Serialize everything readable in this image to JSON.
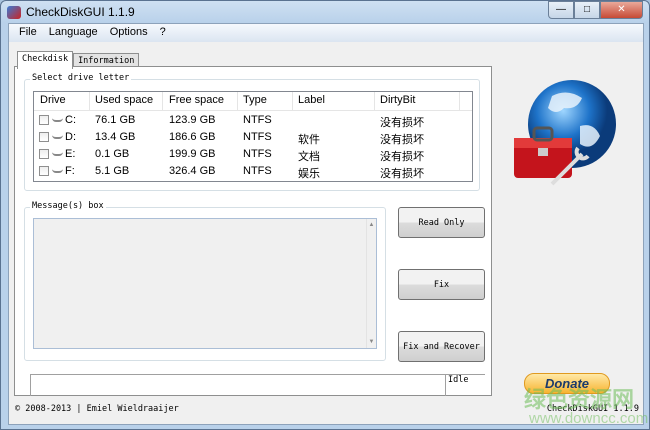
{
  "window": {
    "title": "CheckDiskGUI 1.1.9",
    "controls": [
      "minimize",
      "maximize",
      "close"
    ]
  },
  "menu": [
    "File",
    "Language",
    "Options",
    "?"
  ],
  "tabs": [
    {
      "label": "Checkdisk",
      "active": true
    },
    {
      "label": "Information",
      "active": false
    }
  ],
  "drives": {
    "group_label": "Select drive letter",
    "columns": [
      "Drive",
      "Used space",
      "Free space",
      "Type",
      "Label",
      "DirtyBit"
    ],
    "rows": [
      {
        "drive": "C:",
        "used": "76.1 GB",
        "free": "123.9 GB",
        "type": "NTFS",
        "label": "",
        "dirty": "没有损坏",
        "checked": false
      },
      {
        "drive": "D:",
        "used": "13.4 GB",
        "free": "186.6 GB",
        "type": "NTFS",
        "label": "软件",
        "dirty": "没有损坏",
        "checked": false
      },
      {
        "drive": "E:",
        "used": "0.1 GB",
        "free": "199.9 GB",
        "type": "NTFS",
        "label": "文档",
        "dirty": "没有损坏",
        "checked": false
      },
      {
        "drive": "F:",
        "used": "5.1 GB",
        "free": "326.4 GB",
        "type": "NTFS",
        "label": "娱乐",
        "dirty": "没有损坏",
        "checked": false
      }
    ]
  },
  "messages": {
    "group_label": "Message(s) box",
    "content": ""
  },
  "buttons": {
    "read_only": "Read Only",
    "fix": "Fix",
    "fix_recover": "Fix and Recover",
    "donate": "Donate"
  },
  "status": {
    "text": "Idle"
  },
  "footer": {
    "copyright": "© 2008-2013 | Emiel Wieldraaijer",
    "version": "CheckDiskGUI 1.1.9"
  },
  "watermark": {
    "line1": "绿色资源网",
    "line2": "www.downcc.com"
  }
}
